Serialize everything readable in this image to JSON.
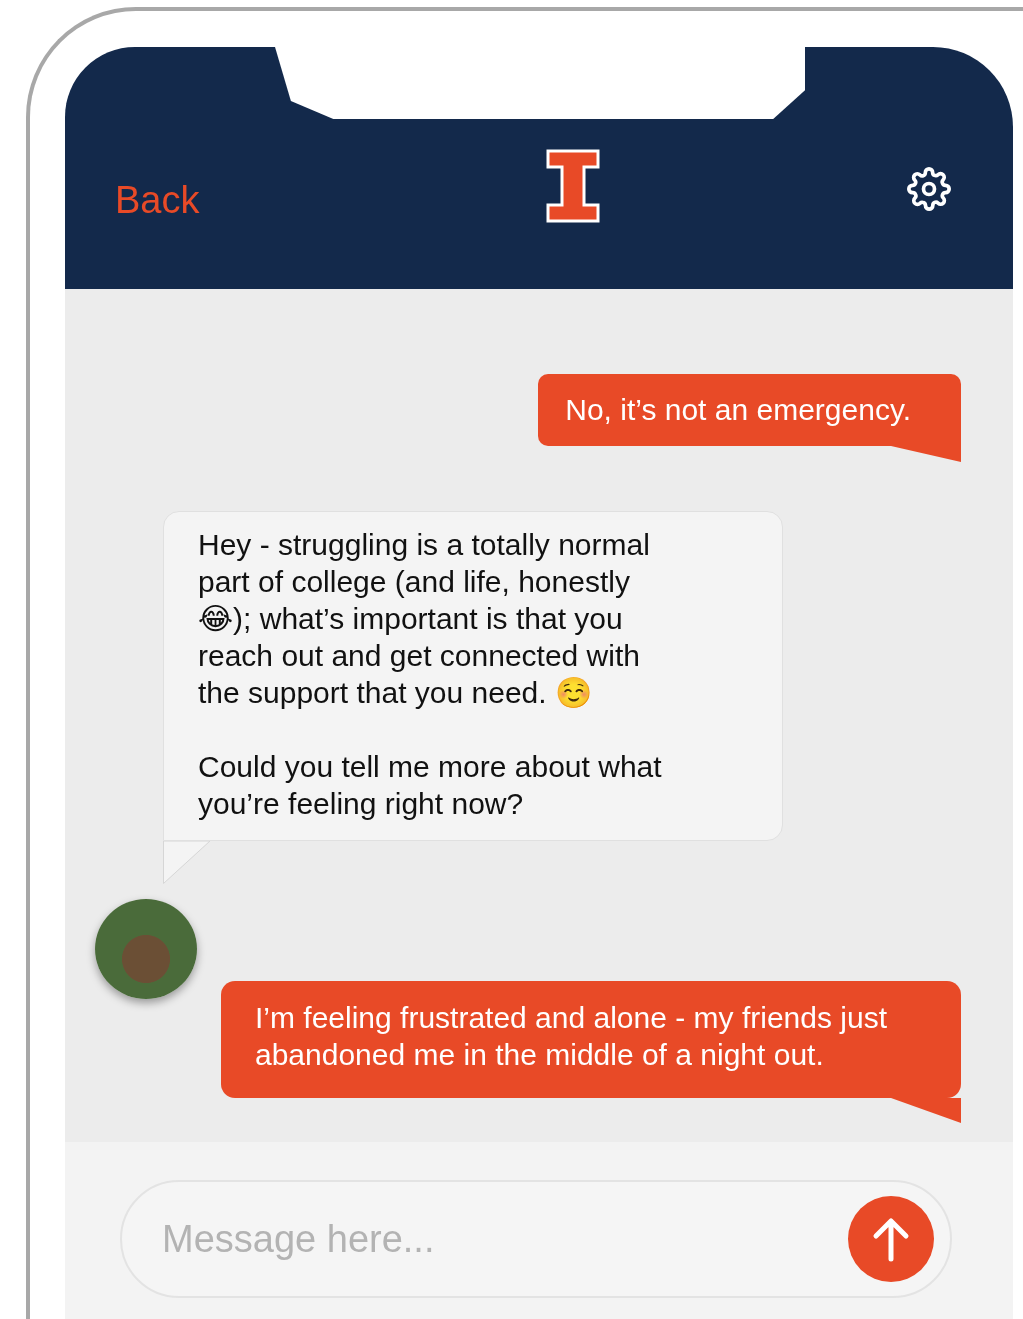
{
  "header": {
    "back": "Back"
  },
  "messages": [
    {
      "kind": "user",
      "paragraphs": [
        "No, it’s not an emergency."
      ]
    },
    {
      "kind": "bot",
      "paragraphs": [
        "Hey - struggling is a totally normal part of college (and life, honestly 😂); what’s important is that you reach out and get connected with the support that you need. ☺️",
        "Could you tell me more about what you’re feeling right now?"
      ]
    },
    {
      "kind": "user",
      "paragraphs": [
        "I’m feeling frustrated and alone - my friends just abandoned me in the middle of a night out."
      ]
    }
  ],
  "composer": {
    "placeholder": "Message here..."
  }
}
